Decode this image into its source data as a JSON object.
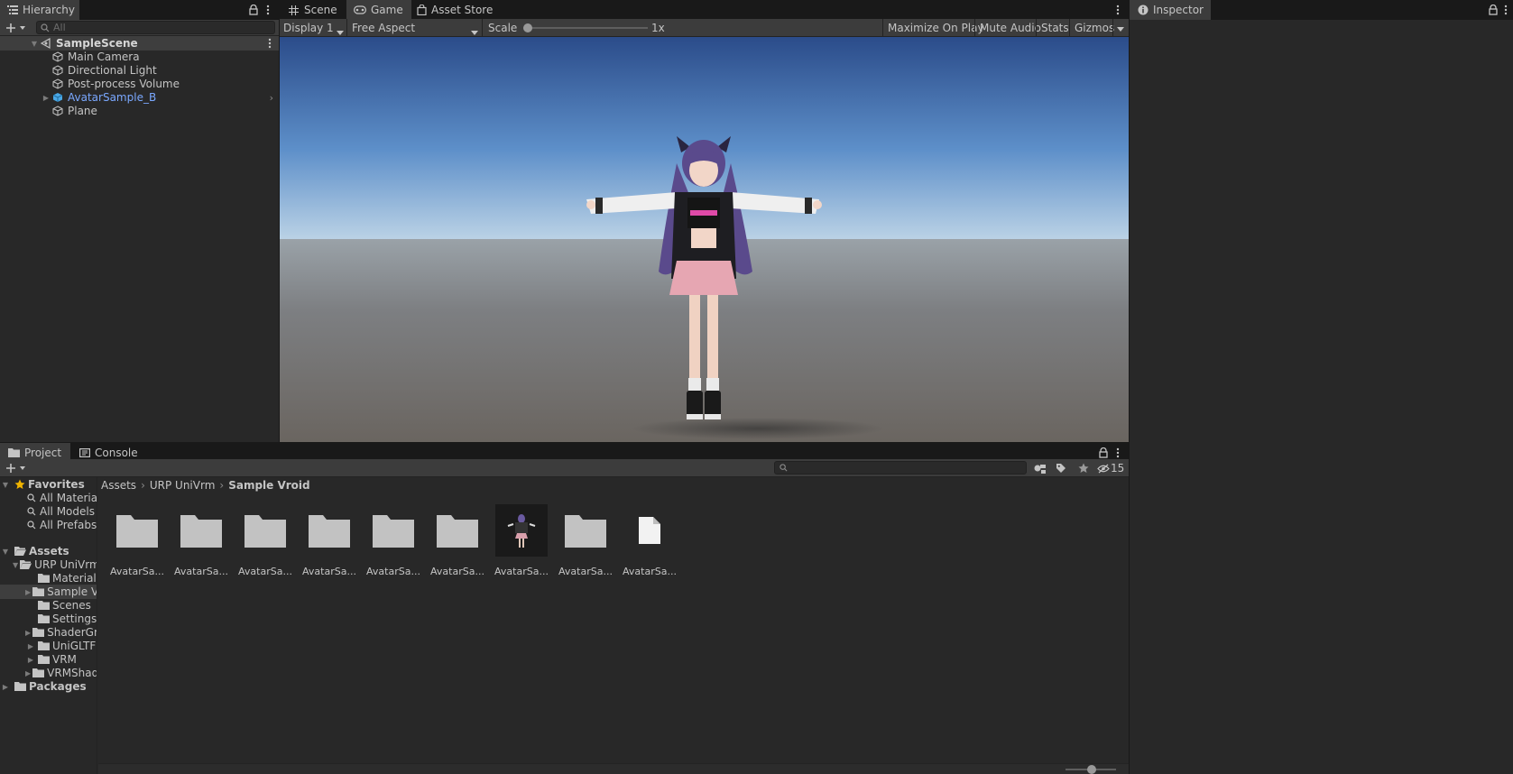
{
  "hierarchy": {
    "title": "Hierarchy",
    "search_placeholder": "All",
    "scene_name": "SampleScene",
    "items": [
      {
        "label": "Main Camera"
      },
      {
        "label": "Directional Light"
      },
      {
        "label": "Post-process Volume"
      },
      {
        "label": "AvatarSample_B"
      },
      {
        "label": "Plane"
      }
    ]
  },
  "center_tabs": {
    "scene": "Scene",
    "game": "Game",
    "asset_store": "Asset Store"
  },
  "game_toolbar": {
    "display": "Display 1",
    "aspect": "Free Aspect",
    "scale_label": "Scale",
    "scale_value": 0.0,
    "scale_text": "1x",
    "maximize": "Maximize On Play",
    "mute": "Mute Audio",
    "stats": "Stats",
    "gizmos": "Gizmos"
  },
  "inspector": {
    "title": "Inspector"
  },
  "project": {
    "tab_project": "Project",
    "tab_console": "Console",
    "hidden_count": "15",
    "breadcrumb": [
      "Assets",
      "URP UniVrm",
      "Sample Vroid"
    ],
    "favorites": {
      "label": "Favorites",
      "items": [
        "All Materials",
        "All Models",
        "All Prefabs"
      ]
    },
    "assets_label": "Assets",
    "urp_label": "URP UniVrm",
    "urp_children": [
      "Materials",
      "Sample Vroid",
      "Scenes",
      "Settings",
      "ShaderGraphs",
      "UniGLTF",
      "VRM",
      "VRMShaders"
    ],
    "packages_label": "Packages",
    "grid": [
      {
        "label": "AvatarSa...",
        "kind": "folder"
      },
      {
        "label": "AvatarSa...",
        "kind": "folder"
      },
      {
        "label": "AvatarSa...",
        "kind": "folder"
      },
      {
        "label": "AvatarSa...",
        "kind": "folder"
      },
      {
        "label": "AvatarSa...",
        "kind": "folder"
      },
      {
        "label": "AvatarSa...",
        "kind": "folder"
      },
      {
        "label": "AvatarSa...",
        "kind": "model"
      },
      {
        "label": "AvatarSa...",
        "kind": "folder"
      },
      {
        "label": "AvatarSa...",
        "kind": "file"
      }
    ]
  },
  "colors": {
    "accent_blue": "#7aa8ff",
    "panel": "#282828",
    "header": "#3c3c3c",
    "star": "#f0b400"
  }
}
